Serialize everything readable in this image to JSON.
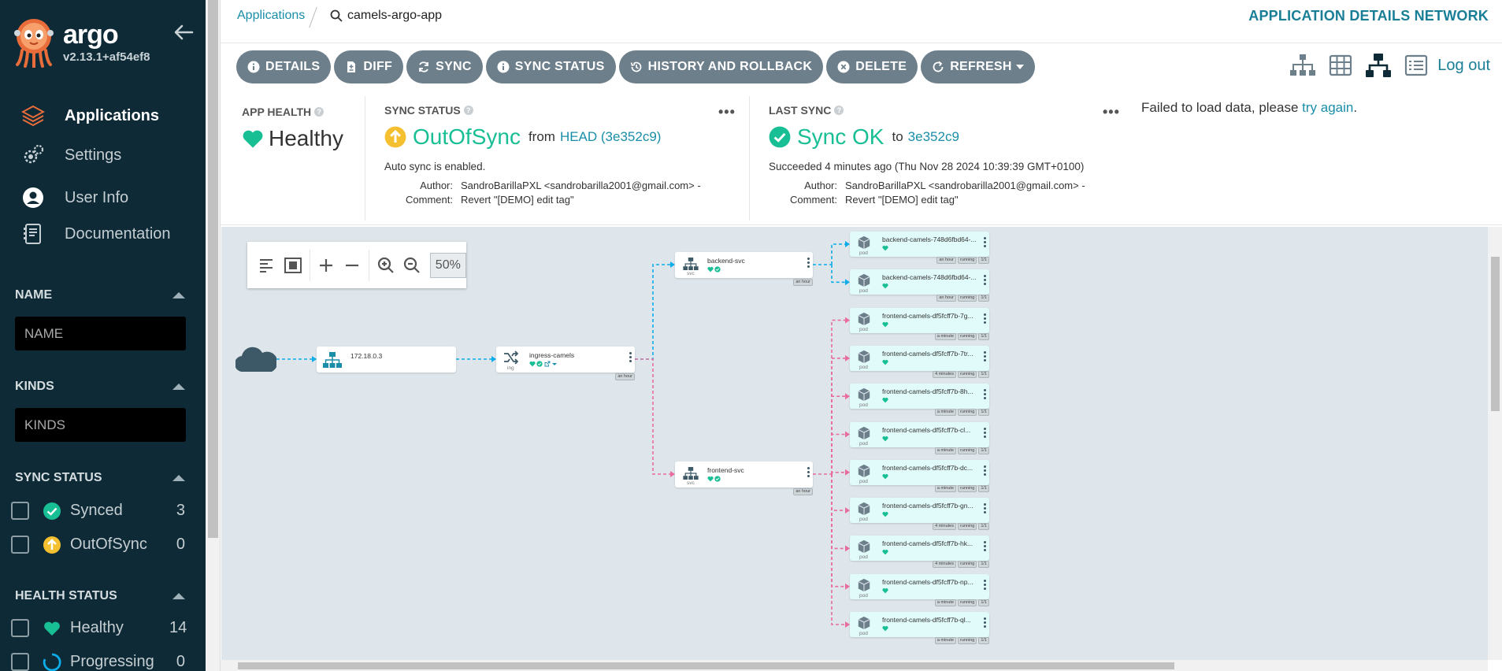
{
  "sidebar": {
    "brand": "argo",
    "version": "v2.13.1+af54ef8",
    "nav": [
      {
        "label": "Applications",
        "icon": "layers-icon",
        "active": true
      },
      {
        "label": "Settings",
        "icon": "gears-icon",
        "active": false
      },
      {
        "label": "User Info",
        "icon": "user-circle-icon",
        "active": false
      },
      {
        "label": "Documentation",
        "icon": "book-icon",
        "active": false
      }
    ],
    "name_filter": {
      "title": "NAME",
      "placeholder": "NAME"
    },
    "kinds_filter": {
      "title": "KINDS",
      "placeholder": "KINDS"
    },
    "sync_status": {
      "title": "SYNC STATUS",
      "items": [
        {
          "label": "Synced",
          "count": "3",
          "color": "#18be94"
        },
        {
          "label": "OutOfSync",
          "count": "0",
          "color": "#f4c030"
        }
      ]
    },
    "health_status": {
      "title": "HEALTH STATUS",
      "items": [
        {
          "label": "Healthy",
          "count": "14",
          "color": "#18be94"
        },
        {
          "label": "Progressing",
          "count": "0",
          "color": "#0dadea"
        }
      ]
    }
  },
  "topbar": {
    "breadcrumb_root": "Applications",
    "breadcrumb_app": "camels-argo-app",
    "title": "APPLICATION DETAILS NETWORK"
  },
  "actions": [
    {
      "label": "DETAILS",
      "icon": "info-icon"
    },
    {
      "label": "DIFF",
      "icon": "file-diff-icon"
    },
    {
      "label": "SYNC",
      "icon": "sync-icon"
    },
    {
      "label": "SYNC STATUS",
      "icon": "info-icon"
    },
    {
      "label": "HISTORY AND ROLLBACK",
      "icon": "history-icon"
    },
    {
      "label": "DELETE",
      "icon": "times-circle-icon"
    },
    {
      "label": "REFRESH",
      "icon": "refresh-icon"
    }
  ],
  "views": {
    "logout": "Log out"
  },
  "app_health": {
    "label": "APP HEALTH",
    "value": "Healthy"
  },
  "sync_status": {
    "label": "SYNC STATUS",
    "value": "OutOfSync",
    "from": "from",
    "revision": "HEAD (3e352c9)",
    "auto_sync": "Auto sync is enabled.",
    "author_key": "Author:",
    "author": "SandroBarillaPXL <sandrobarilla2001@gmail.com> -",
    "comment_key": "Comment:",
    "comment": "Revert \"[DEMO] edit tag\""
  },
  "last_sync": {
    "label": "LAST SYNC",
    "value": "Sync OK",
    "to": "to",
    "revision": "3e352c9",
    "succeeded": "Succeeded 4 minutes ago (Thu Nov 28 2024 10:39:39 GMT+0100)",
    "author_key": "Author:",
    "author": "SandroBarillaPXL <sandrobarilla2001@gmail.com> -",
    "comment_key": "Comment:",
    "comment": "Revert \"[DEMO] edit tag\""
  },
  "failed": {
    "text": "Failed to load data, please ",
    "link": "try again",
    "end": "."
  },
  "graph": {
    "zoom": "50%",
    "ip_node": "172.18.0.3",
    "ingress": {
      "name": "ingress-camels",
      "kind": "ing",
      "age": "an hour"
    },
    "services": [
      {
        "name": "backend-svc",
        "kind": "svc",
        "age": "an hour"
      },
      {
        "name": "frontend-svc",
        "kind": "svc",
        "age": "an hour"
      }
    ],
    "pods": [
      {
        "name": "backend-camels-748d6fbd64-...",
        "age": "an hour",
        "status": "running",
        "ready": "1/1",
        "group": "backend"
      },
      {
        "name": "backend-camels-748d6fbd64-...",
        "age": "an hour",
        "status": "running",
        "ready": "1/1",
        "group": "backend"
      },
      {
        "name": "frontend-camels-df5fcff7b-7g...",
        "age": "a minute",
        "status": "running",
        "ready": "1/1",
        "group": "frontend"
      },
      {
        "name": "frontend-camels-df5fcff7b-7tr...",
        "age": "4 minutes",
        "status": "running",
        "ready": "1/1",
        "group": "frontend"
      },
      {
        "name": "frontend-camels-df5fcff7b-8h...",
        "age": "a minute",
        "status": "running",
        "ready": "1/1",
        "group": "frontend"
      },
      {
        "name": "frontend-camels-df5fcff7b-cl...",
        "age": "a minute",
        "status": "running",
        "ready": "1/1",
        "group": "frontend"
      },
      {
        "name": "frontend-camels-df5fcff7b-dc...",
        "age": "a minute",
        "status": "running",
        "ready": "1/1",
        "group": "frontend"
      },
      {
        "name": "frontend-camels-df5fcff7b-gn...",
        "age": "4 minutes",
        "status": "running",
        "ready": "1/1",
        "group": "frontend"
      },
      {
        "name": "frontend-camels-df5fcff7b-hk...",
        "age": "4 minutes",
        "status": "running",
        "ready": "1/1",
        "group": "frontend"
      },
      {
        "name": "frontend-camels-df5fcff7b-np...",
        "age": "a minute",
        "status": "running",
        "ready": "1/1",
        "group": "frontend"
      },
      {
        "name": "frontend-camels-df5fcff7b-ql...",
        "age": "a minute",
        "status": "running",
        "ready": "1/1",
        "group": "frontend"
      }
    ],
    "pod_kind": "pod"
  }
}
